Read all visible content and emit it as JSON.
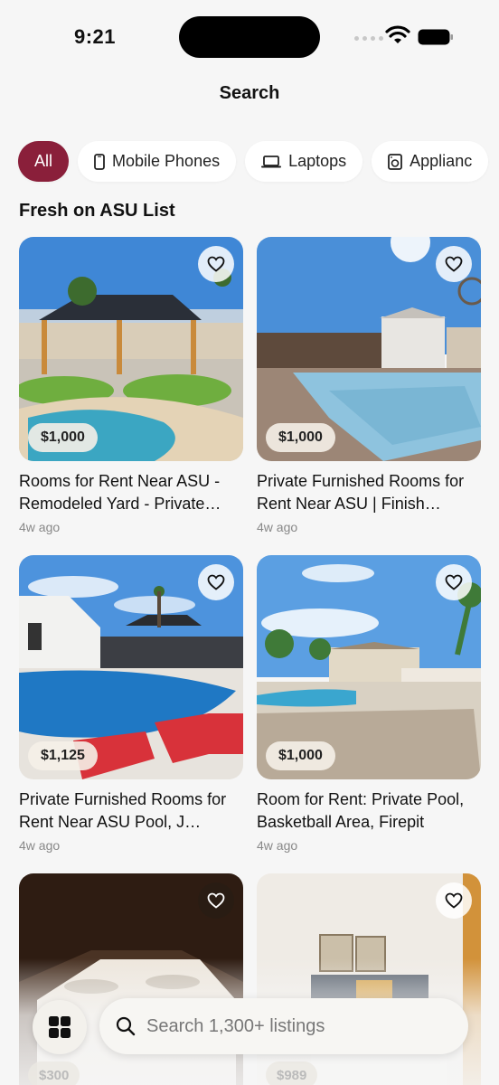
{
  "status_bar": {
    "time": "9:21"
  },
  "header": {
    "title": "Search"
  },
  "categories": [
    {
      "label": "All",
      "icon": "none",
      "active": true
    },
    {
      "label": "Mobile Phones",
      "icon": "phone-icon"
    },
    {
      "label": "Laptops",
      "icon": "laptop-icon"
    },
    {
      "label": "Applianc",
      "icon": "appliance-icon"
    }
  ],
  "section": {
    "title": "Fresh on ASU List"
  },
  "listings": [
    {
      "price": "$1,000",
      "title": "Rooms for Rent Near ASU - Remodeled Yard - Private…",
      "age": "4w ago"
    },
    {
      "price": "$1,000",
      "title": "Private Furnished Rooms for Rent Near ASU | Finish…",
      "age": "4w ago"
    },
    {
      "price": "$1,125",
      "title": "Private Furnished Rooms for Rent Near ASU Pool, J…",
      "age": "4w ago"
    },
    {
      "price": "$1,000",
      "title": "Room for Rent: Private Pool, Basketball Area, Firepit",
      "age": "4w ago"
    },
    {
      "price": "$300",
      "title": "",
      "age": ""
    },
    {
      "price": "$989",
      "title": "",
      "age": ""
    }
  ],
  "search": {
    "placeholder": "Search 1,300+ listings"
  },
  "colors": {
    "accent": "#8a1f3a",
    "background": "#f6f6f6"
  }
}
